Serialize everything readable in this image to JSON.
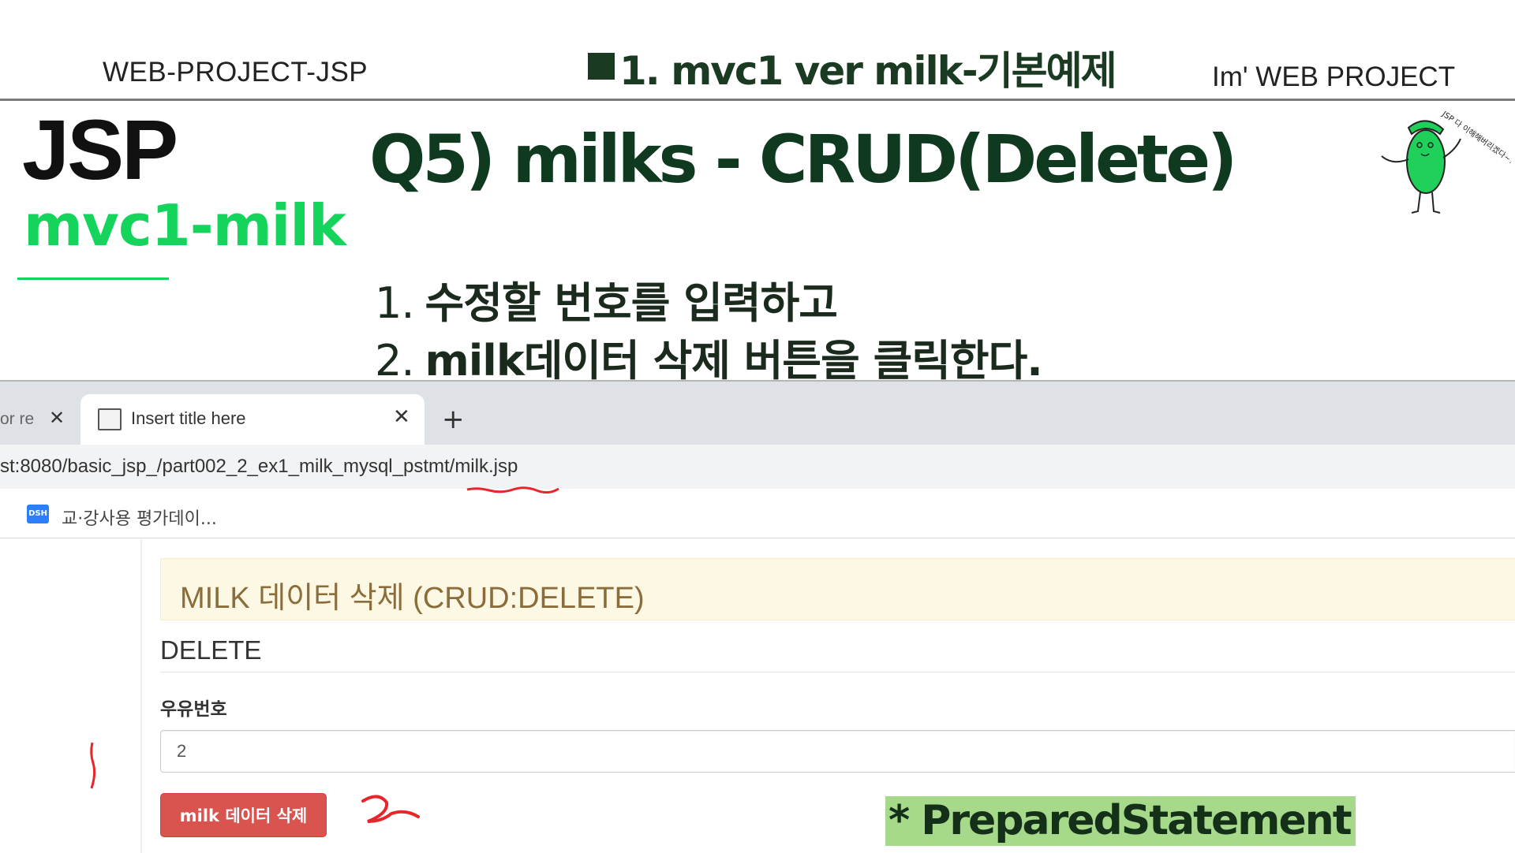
{
  "slide": {
    "header_left": "WEB-PROJECT-JSP",
    "header_center": "1. mvc1 ver  milk-기본예제",
    "header_right": "Im'  WEB PROJECT",
    "left_title": "JSP",
    "left_subtitle": "mvc1-milk",
    "question_title": "Q5) milks - CRUD(Delete)",
    "steps": [
      {
        "num": "1.",
        "text": "수정할 번호를 입력하고"
      },
      {
        "num": "2.",
        "text": "milk데이터 삭제 버튼을 클릭한다."
      }
    ],
    "mascot_caption": "JSP 다 이해해버리겠다~!",
    "note": "* PreparedStatement",
    "colors": {
      "title_dark_green": "#0f3a1f",
      "accent_green": "#14d45c",
      "highlight_green": "#a6d98a",
      "annotation_red": "#e8252a"
    }
  },
  "browser": {
    "prev_tab_label": "or re",
    "active_tab_title": "Insert title here",
    "new_tab_symbol": "+",
    "close_symbol": "✕",
    "url": "st:8080/basic_jsp_/part002_2_ex1_milk_mysql_pstmt/milk.jsp",
    "bookmark_icon_text": "DSH",
    "bookmark_label": "교·강사용 평가데이..."
  },
  "page": {
    "panel_heading": "MILK 데이터 삭제 (CRUD:DELETE)",
    "legend": "DELETE",
    "field_label": "우유번호",
    "field_value": "2",
    "delete_button": "milk 데이터 삭제"
  }
}
